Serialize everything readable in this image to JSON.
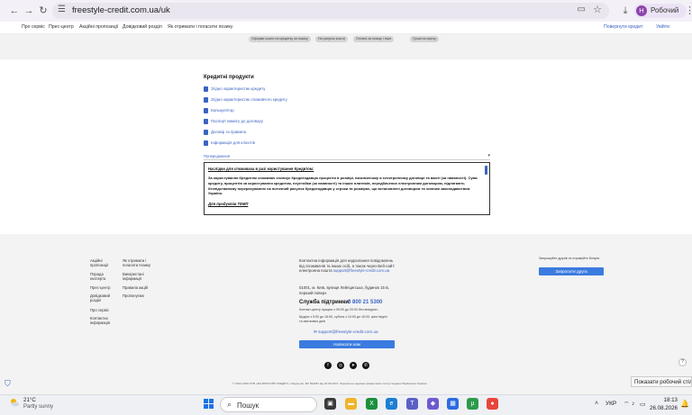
{
  "browser": {
    "url": "freestyle-credit.com.ua/uk",
    "profile_initial": "Н",
    "profile_name": "Робочий"
  },
  "site_nav": {
    "items": [
      "Про сервіс",
      "Прес-центр",
      "Акційні пропозиції",
      "Довідковий розділ",
      "Як отримати і погасити позику"
    ],
    "right": [
      "Повернути кредит",
      "Увійти"
    ]
  },
  "chips": [
    "Оформи кошти на кредитку за позику",
    "На рахунок кошти",
    "Оплата за позику і інше",
    "Гроші на картку"
  ],
  "credit_products": {
    "title": "Кредитні продукти",
    "links": [
      "Згідно характеристик кредиту",
      "Згідно характеристик споживчого кредиту",
      "Калькулятор",
      "Паспорт вимогу до договору",
      "Договір та правила",
      "Інформація для клієнтів"
    ]
  },
  "warning": {
    "header": "Попередження",
    "title": "Наслідки для споживача в разі користування Кредитом:",
    "body": "За користування Кредитом споживач сплачує Кредитодавцю проценти в розмірі, визначеному в електронному договорі та вжиті (за наявності). Сума кредиту, процентів за користування кредитом, неустойки (за наявності) та інших платежів, передбачених електронним договором, підлягають безпідставному перерахуванню на поточний рахунок Кредитодавцю у строки та розмірах, що встановлені договором та чинним законодавством України.",
    "footer_link": "Для продуктів ТЕМП"
  },
  "footer": {
    "col1": [
      "Акційні пропозиції",
      "Порада експерта",
      "Прес-центр",
      "Довідковий розділ",
      "Про сервіс",
      "Контактна інформація"
    ],
    "col2": [
      "Як отримати і погасити позику",
      "Використані інформації",
      "Правила акцій",
      "Пропонуємо"
    ],
    "info": "Контактна інформація для надсилання повідомлень від споживачів та інших осіб, а також через Веб-сайт: електронна пошта",
    "info_link": "support@freestyle-credit.com.ua",
    "address": "01001, м. Київ, вулиця Лейпцигська, будинок 15 Б, перший поверх",
    "support_title": "Служба підтримки:",
    "support_phone": "0 800 21 5300",
    "schedule": "Контакт-центр працює з 09:00 до 20:00 без вихідних.",
    "schedule2": "Щодня з 9:00 до 18:00, субота з 10:00 до 16:00, крім неділі та святкових днів",
    "email": "support@freestyle-credit.com.ua",
    "write_btn": "Написати нам",
    "invite_text": "Запрошуйте друзів та отримуйте бонуси",
    "invite_btn": "Запросити друга",
    "copyright": "© 2021-2026 ТОВ «ФК ФРІСТАЙЛ КРЕДИТ». Свідоцтво: ФК №2281 від 22.06.2021. Ліцензія на надання фінансових послуг видана Нацбанком України."
  },
  "help_symbol": "?",
  "desktop_tip": "Показати робочий стіл",
  "taskbar": {
    "temp": "21°C",
    "weather": "Partly sunny",
    "search_placeholder": "Пошук",
    "lang": "УКР",
    "time": "18:13",
    "date": "26.08.2026"
  },
  "colors": {
    "accent": "#3b63c2",
    "button": "#3b7be0"
  }
}
